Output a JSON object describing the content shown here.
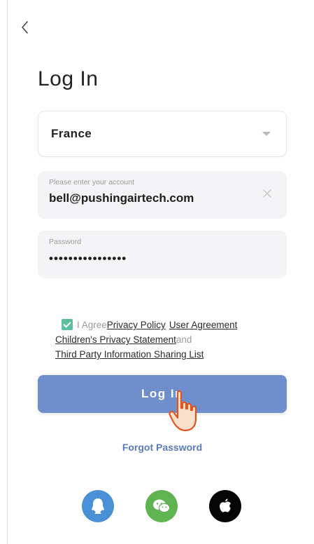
{
  "header": {
    "title": "Log In"
  },
  "country": {
    "value": "France"
  },
  "account": {
    "label": "Please enter your account",
    "value": "bell@pushingairtech.com"
  },
  "password": {
    "label": "Password",
    "value": "••••••••••••••••"
  },
  "agreement": {
    "prefix": "I Agree",
    "privacy_policy": "Privacy Policy",
    "user_agreement": "User Agreement",
    "childrens_privacy": "Children's Privacy Statement",
    "and": "and",
    "third_party": "Third Party Information Sharing List",
    "checked": true
  },
  "buttons": {
    "login": "Log In",
    "forgot": "Forgot Password"
  },
  "social": [
    "qq-icon",
    "wechat-icon",
    "apple-icon"
  ],
  "colors": {
    "primary": "#6f8fcc",
    "link": "#5a7bbd",
    "check": "#5cc09b",
    "qq": "#4a90d6",
    "wechat": "#5fb350",
    "apple": "#050505"
  }
}
